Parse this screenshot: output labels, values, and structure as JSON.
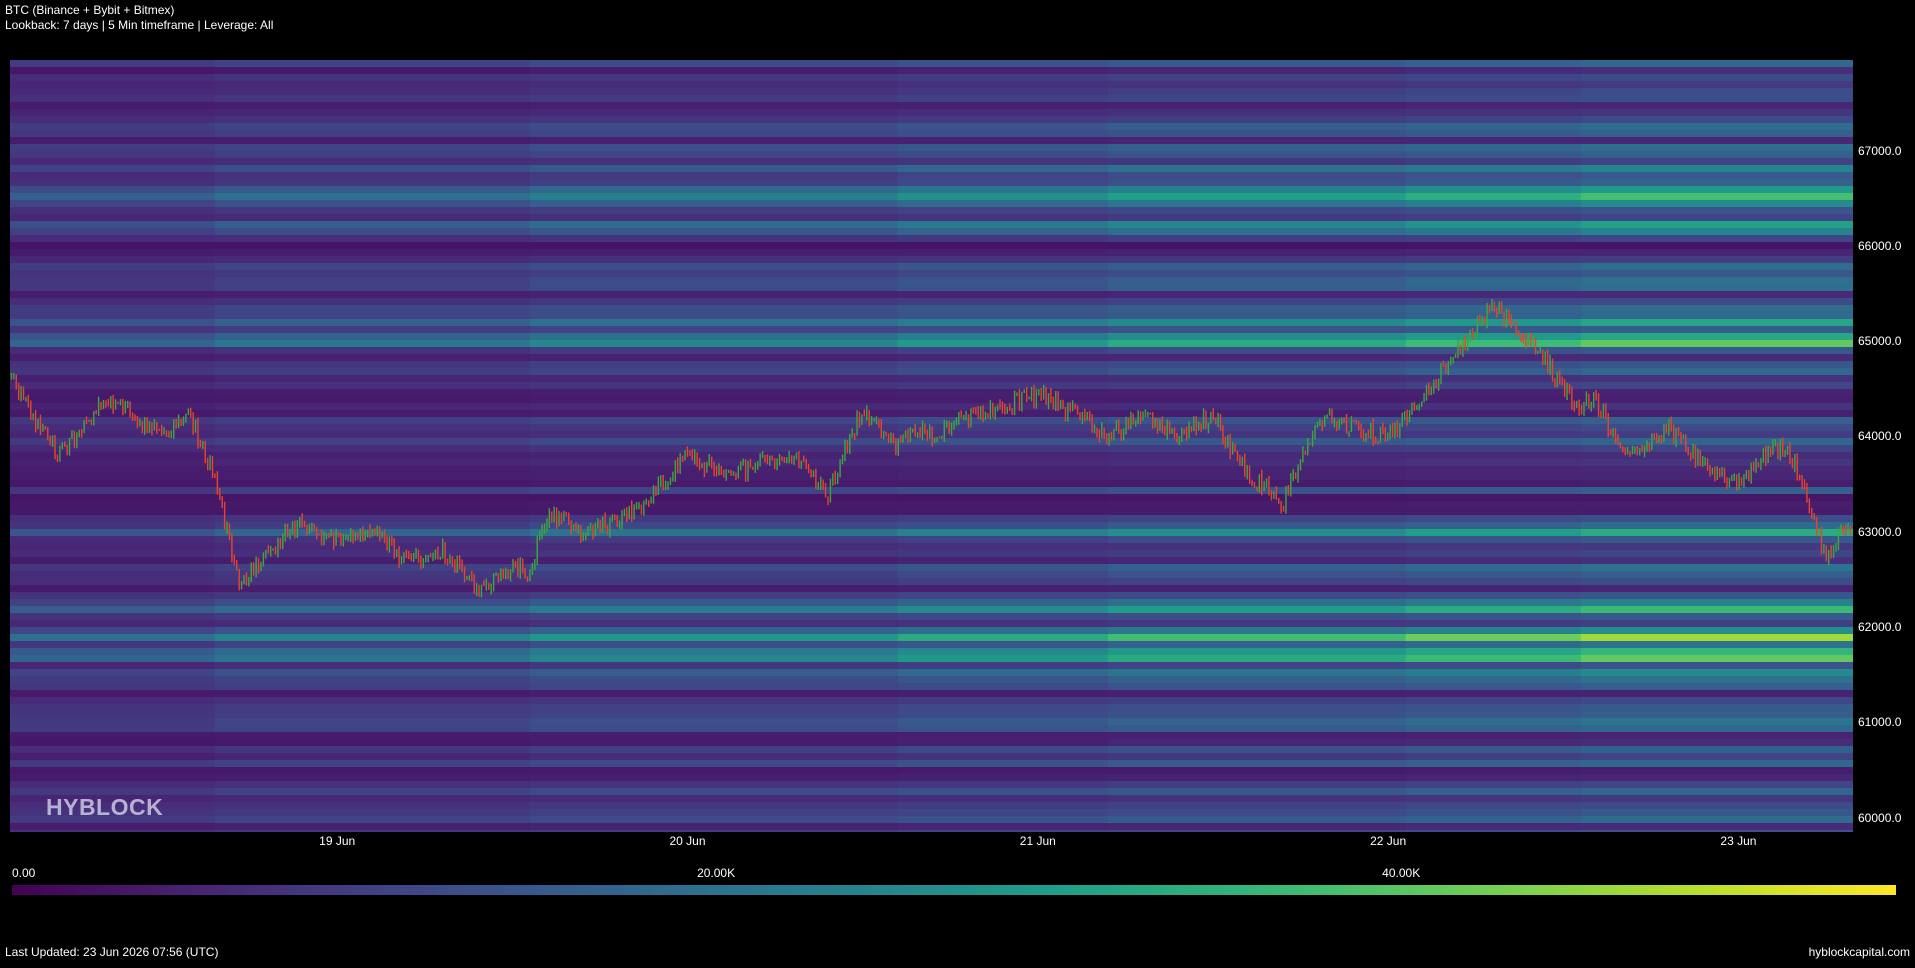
{
  "header": {
    "title": "BTC (Binance + Bybit + Bitmex)",
    "subtitle": "Lookback: 7 days | 5 Min timeframe | Leverage: All"
  },
  "watermark": "HYBLOCK",
  "footer": {
    "last_updated": "Last Updated: 23 Jun 2026 07:56 (UTC)",
    "site": "hyblockcapital.com"
  },
  "colorbar": {
    "labels": [
      "0.00",
      "20.00K",
      "40.00K"
    ],
    "min": 0,
    "max": 55000,
    "colormap": "viridis"
  },
  "chart_data": {
    "type": "heatmap",
    "title": "BTC (Binance + Bybit + Bitmex)",
    "xlabel": "",
    "ylabel": "",
    "x_tick_labels": [
      "19 Jun",
      "20 Jun",
      "21 Jun",
      "22 Jun",
      "23 Jun"
    ],
    "x_tick_days": [
      19,
      20,
      21,
      22,
      23
    ],
    "xlim_days": [
      18.066,
      23.327
    ],
    "y_tick_labels": [
      "60000.0",
      "61000.0",
      "62000.0",
      "63000.0",
      "64000.0",
      "65000.0",
      "66000.0",
      "67000.0"
    ],
    "y_tick_values": [
      60000,
      61000,
      62000,
      63000,
      64000,
      65000,
      66000,
      67000
    ],
    "ylim": [
      59850,
      67950
    ],
    "grid": false,
    "legend": "colorbar bottom",
    "colors": {
      "low": "#440154",
      "mid": "#21918c",
      "high": "#fde725",
      "candle_up": "#3fa63f",
      "candle_down": "#e8442c"
    },
    "price_series": {
      "name": "",
      "x_days": [
        18.07,
        18.2,
        18.35,
        18.5,
        18.58,
        18.65,
        18.72,
        18.8,
        18.9,
        19.0,
        19.1,
        19.2,
        19.3,
        19.4,
        19.5,
        19.55,
        19.6,
        19.7,
        19.8,
        19.9,
        20.0,
        20.1,
        20.2,
        20.3,
        20.4,
        20.5,
        20.6,
        20.65,
        20.7,
        20.8,
        20.9,
        21.0,
        21.1,
        21.2,
        21.3,
        21.35,
        21.4,
        21.5,
        21.6,
        21.7,
        21.8,
        21.9,
        22.0,
        22.05,
        22.1,
        22.2,
        22.3,
        22.4,
        22.45,
        22.5,
        22.55,
        22.58,
        22.6,
        22.65,
        22.7,
        22.8,
        22.9,
        23.0,
        23.1,
        23.15,
        23.2,
        23.25,
        23.3,
        23.32
      ],
      "close": [
        64600,
        63800,
        64400,
        64000,
        64200,
        63600,
        62400,
        62800,
        63100,
        62900,
        63000,
        62700,
        62800,
        62400,
        62600,
        62600,
        63200,
        63000,
        63100,
        63400,
        63800,
        63600,
        63700,
        63800,
        63400,
        64300,
        63900,
        64100,
        64000,
        64200,
        64300,
        64450,
        64250,
        64000,
        64200,
        64100,
        64000,
        64200,
        63600,
        63300,
        64200,
        64100,
        64000,
        64200,
        64400,
        64900,
        65400,
        65000,
        64800,
        64500,
        64300,
        64400,
        64300,
        64000,
        63800,
        64100,
        63700,
        63500,
        63900,
        63800,
        63300,
        62700,
        63050,
        63000
      ]
    },
    "liquidation_levels": [
      {
        "price": 67900,
        "intensity": 12000
      },
      {
        "price": 67600,
        "intensity": 14000
      },
      {
        "price": 67200,
        "intensity": 16000
      },
      {
        "price": 66800,
        "intensity": 26000
      },
      {
        "price": 66600,
        "intensity": 30000
      },
      {
        "price": 66500,
        "intensity": 42000
      },
      {
        "price": 66200,
        "intensity": 36000
      },
      {
        "price": 65600,
        "intensity": 26000
      },
      {
        "price": 65200,
        "intensity": 32000
      },
      {
        "price": 65000,
        "intensity": 48000
      },
      {
        "price": 64700,
        "intensity": 20000
      },
      {
        "price": 63000,
        "intensity": 34000
      },
      {
        "price": 62600,
        "intensity": 24000
      },
      {
        "price": 62200,
        "intensity": 40000
      },
      {
        "price": 61900,
        "intensity": 48000
      },
      {
        "price": 61700,
        "intensity": 50000
      },
      {
        "price": 61500,
        "intensity": 30000
      },
      {
        "price": 61000,
        "intensity": 22000
      },
      {
        "price": 60700,
        "intensity": 18000
      },
      {
        "price": 60300,
        "intensity": 16000
      }
    ]
  }
}
